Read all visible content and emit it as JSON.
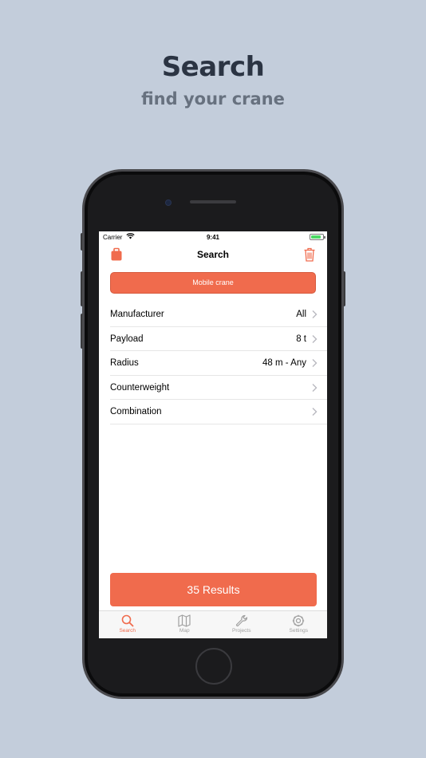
{
  "hero": {
    "title": "Search",
    "subtitle": "find your crane"
  },
  "status_bar": {
    "carrier": "Carrier",
    "time": "9:41"
  },
  "nav": {
    "title": "Search"
  },
  "crane_type_button": "Mobile crane",
  "filters": [
    {
      "label": "Manufacturer",
      "value": "All"
    },
    {
      "label": "Payload",
      "value": "8 t"
    },
    {
      "label": "Radius",
      "value": "48 m - Any"
    },
    {
      "label": "Counterweight",
      "value": ""
    },
    {
      "label": "Combination",
      "value": ""
    }
  ],
  "results_button": "35 Results",
  "tabs": [
    {
      "label": "Search",
      "icon": "search-icon",
      "active": true
    },
    {
      "label": "Map",
      "icon": "map-icon",
      "active": false
    },
    {
      "label": "Projects",
      "icon": "wrench-icon",
      "active": false
    },
    {
      "label": "Settings",
      "icon": "gear-icon",
      "active": false
    }
  ],
  "colors": {
    "accent": "#f06b4d",
    "background": "#c3cddb",
    "heading": "#2b3443",
    "subheading": "#67717f"
  }
}
